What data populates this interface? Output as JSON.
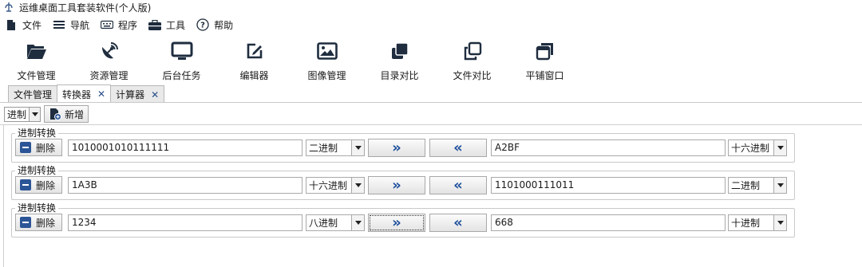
{
  "window": {
    "title": "运维桌面工具套装软件(个人版)"
  },
  "menu": [
    {
      "label": "文件",
      "icon": "file-icon"
    },
    {
      "label": "导航",
      "icon": "menu-lines-icon"
    },
    {
      "label": "程序",
      "icon": "keyboard-icon"
    },
    {
      "label": "工具",
      "icon": "toolbox-icon"
    },
    {
      "label": "帮助",
      "icon": "help-circle-icon"
    }
  ],
  "toolbar": [
    {
      "label": "文件管理",
      "icon": "folder-open-icon"
    },
    {
      "label": "资源管理",
      "icon": "satellite-dish-icon"
    },
    {
      "label": "后台任务",
      "icon": "monitor-icon"
    },
    {
      "label": "编辑器",
      "icon": "edit-icon"
    },
    {
      "label": "图像管理",
      "icon": "image-icon"
    },
    {
      "label": "目录对比",
      "icon": "stacked-squares-icon"
    },
    {
      "label": "文件对比",
      "icon": "copy-outline-icon"
    },
    {
      "label": "平铺窗口",
      "icon": "tile-window-icon"
    }
  ],
  "tabs": [
    {
      "label": "文件管理",
      "closable": false,
      "active": false
    },
    {
      "label": "转换器",
      "closable": true,
      "active": true
    },
    {
      "label": "计算器",
      "closable": true,
      "active": false
    }
  ],
  "subbar": {
    "mode": "进制",
    "add_label": "新增"
  },
  "converter": {
    "group_title": "进制转换",
    "delete_label": "删除",
    "forward_label": "»",
    "backward_label": "«",
    "rows": [
      {
        "left_value": "1010001010111111",
        "left_base": "二进制",
        "right_value": "A2BF",
        "right_base": "十六进制"
      },
      {
        "left_value": "1A3B",
        "left_base": "十六进制",
        "right_value": "1101000111011",
        "right_base": "二进制"
      },
      {
        "left_value": "1234",
        "left_base": "八进制",
        "right_value": "668",
        "right_base": "十进制"
      }
    ]
  },
  "colors": {
    "accent": "#1d4f9c",
    "icon": "#1f2d3f",
    "border": "#a9a9a9"
  }
}
